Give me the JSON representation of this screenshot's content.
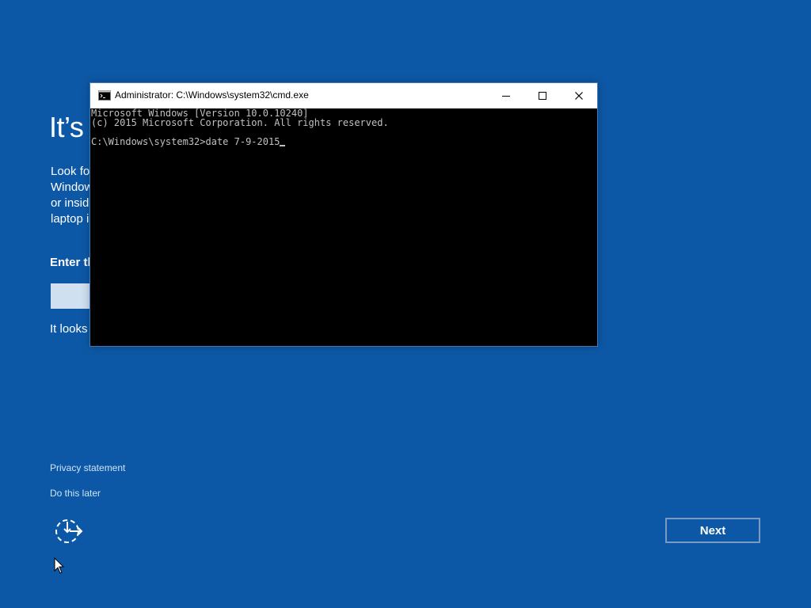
{
  "oobe": {
    "title": "It’s t",
    "description_lines": [
      "Look fo",
      "Window",
      "or insid",
      "laptop i"
    ],
    "input_label": "Enter th",
    "note": "It looks",
    "privacy_link": "Privacy statement",
    "later_link": "Do this later",
    "next_label": "Next",
    "ease_of_access_icon": "ease-of-access-icon"
  },
  "cmd": {
    "title": "Administrator: C:\\Windows\\system32\\cmd.exe",
    "lines": [
      "Microsoft Windows [Version 10.0.10240]",
      "(c) 2015 Microsoft Corporation. All rights reserved.",
      "",
      "C:\\Windows\\system32>date 7-9-2015"
    ],
    "app_icon": "cmd-icon",
    "buttons": [
      "minimize-icon",
      "maximize-icon",
      "close-icon"
    ]
  },
  "colors": {
    "background": "#0d58a6",
    "console_text": "#c0c0c0",
    "console_bg": "#000000",
    "next_border": "#7a9cc4"
  }
}
